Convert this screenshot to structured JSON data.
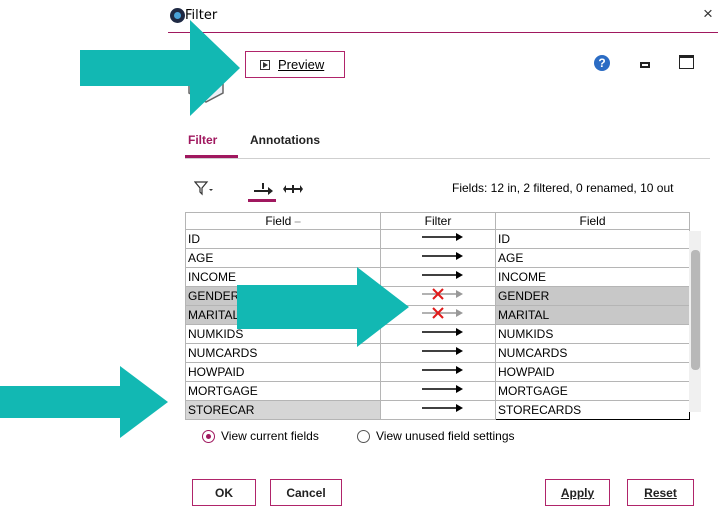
{
  "window": {
    "title": "Filter"
  },
  "toolbar": {
    "preview_label": "Preview"
  },
  "tabs": [
    {
      "label": "Filter"
    },
    {
      "label": "Annotations"
    }
  ],
  "summary": "Fields: 12 in, 2 filtered, 0 renamed, 10 out",
  "table": {
    "headers": [
      "Field",
      "Filter",
      "Field"
    ],
    "rows": [
      {
        "in": "ID",
        "out": "ID",
        "filtered": false
      },
      {
        "in": "AGE",
        "out": "AGE",
        "filtered": false
      },
      {
        "in": "INCOME",
        "out": "INCOME",
        "filtered": false
      },
      {
        "in": "GENDER",
        "out": "GENDER",
        "filtered": true
      },
      {
        "in": "MARITAL",
        "out": "MARITAL",
        "filtered": true
      },
      {
        "in": "NUMKIDS",
        "out": "NUMKIDS",
        "filtered": false
      },
      {
        "in": "NUMCARDS",
        "out": "NUMCARDS",
        "filtered": false
      },
      {
        "in": "HOWPAID",
        "out": "HOWPAID",
        "filtered": false
      },
      {
        "in": "MORTGAGE",
        "out": "MORTGAGE",
        "filtered": false
      },
      {
        "in": "STORECAR",
        "out": "STORECARDS",
        "filtered": false,
        "selected": true
      }
    ]
  },
  "radios": [
    {
      "label": "View current fields",
      "checked": true
    },
    {
      "label": "View unused field settings",
      "checked": false
    }
  ],
  "buttons": {
    "ok": "OK",
    "cancel": "Cancel",
    "apply": "Apply",
    "reset": "Reset"
  },
  "colors": {
    "accent": "#a0185f",
    "annotation_arrow": "#12b8b3",
    "filter_x": "#e01b1b"
  }
}
